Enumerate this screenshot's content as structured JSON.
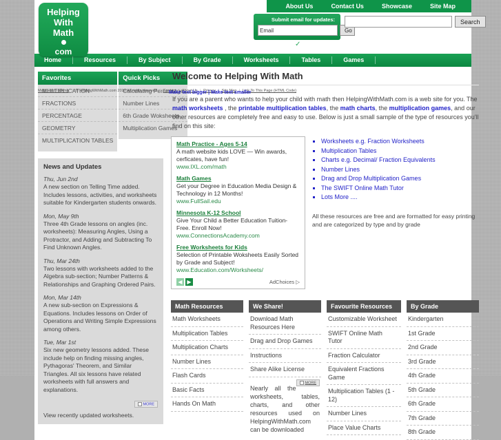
{
  "logo": {
    "line1": "Helping",
    "line2": "With",
    "line3": "Math",
    "line4": "com"
  },
  "topnav": {
    "items": [
      {
        "label": "About Us"
      },
      {
        "label": "Contact Us"
      },
      {
        "label": "Showcase"
      },
      {
        "label": "Site Map"
      }
    ]
  },
  "email_signup": {
    "label": "Submit email for updates:",
    "input_value": "Email",
    "placeholder": "Email",
    "button": "Go"
  },
  "search": {
    "value": "",
    "placeholder": "",
    "button": "Search"
  },
  "mainnav": {
    "items": [
      {
        "label": "Home"
      },
      {
        "label": "Resources"
      },
      {
        "label": "By Subject"
      },
      {
        "label": "By Grade"
      },
      {
        "label": "Worksheets"
      },
      {
        "label": "Tables"
      },
      {
        "label": "Games"
      }
    ]
  },
  "breadcrumb": {
    "home": "Math Help - Home",
    "copyright": "© HelpingWithMath.com 2010 All rights reserved",
    "contact": "Contact",
    "about": "About Us",
    "privacy": "Privacy",
    "sitemap": "Site Map",
    "linkto": "Link To This Page (HTML Code)",
    "resize": "Make text bigger | Make text smaller"
  },
  "favorites": {
    "title": "Favorites",
    "items": [
      "MULTIPLICATION",
      "FRACTIONS",
      "PERCENTAGE",
      "GEOMETRY",
      "MULTIPLICATION TABLES"
    ]
  },
  "quickpicks": {
    "title": "Quick Picks",
    "items": [
      "Calculating Percentage",
      "Number Lines",
      "6th Grade Woksheets",
      "Multiplication Games"
    ]
  },
  "news": {
    "title": "News and Updates",
    "entries": [
      {
        "date": "Thu, Jun 2nd",
        "text": "A new section on Telling Time added. Includes lessons, activities, and worksheets suitable for Kindergarten students onwards."
      },
      {
        "date": "Mon, May 9th",
        "text": "Three 4th Grade lessons on angles (inc. worksheets): Measuring Angles, Using a Protractor, and Adding and Subtracting To Find Unknown Angles."
      },
      {
        "date": "Thu, Mar 24th",
        "text": "Two lessons with worksheets added to the Algebra sub-section; Number Patterns & Relationships and Graphing Ordered Pairs."
      },
      {
        "date": "Mon, Mar 14th",
        "text": "A new sub-section on Expressions & Equations. Includes lessons on Order of Operations and Writing Simple Expressions among others."
      },
      {
        "date": "Tue, Mar 1st",
        "text": "Six new geometry lessons added. These include help on finding missing angles, Pythagoras' Theorem, and Similar Triangles. All six lessons have related worksheets with full answers and explanations."
      }
    ],
    "more_label": "MORE",
    "view_text": "View recently updated worksheets."
  },
  "welcome": {
    "heading": "Welcome to Helping With Math",
    "intro_1": "If you are a parent who wants to help your child with math then HelpingWithMath.com is a web site for you. The ",
    "link_worksheets": "math worksheets",
    "intro_2": " , the ",
    "link_tables": "printable multiplication tables",
    "intro_3": ", the ",
    "link_charts": "math charts",
    "intro_4": ", the ",
    "link_games": "multiplication games",
    "intro_5": ", and our other resources are completely free and easy to use. Below is just a small sample of the type of resources you'll find on this site:"
  },
  "ads": {
    "items": [
      {
        "title": "Math Practice - Ages 5-14",
        "desc": "A math website kids LOVE — Win awards, cerficates, have fun!",
        "url": "www.IXL.com/math"
      },
      {
        "title": "Math Games",
        "desc": "Get your Degree in Education Media Design & Technology in 12 Months!",
        "url": "www.FullSail.edu"
      },
      {
        "title": "Minnesota K-12 School",
        "desc": "Give Your Child a Better Education Tuition-Free. Enroll Now!",
        "url": "www.ConnectionsAcademy.com"
      },
      {
        "title": "Free Worksheets for Kids",
        "desc": "Selection of Printable Woksheets Easily Sorted by Grade and Subject!",
        "url": "www.Education.com/Worksheets/"
      }
    ],
    "prev": "◀",
    "next": "▶",
    "adchoices": "AdChoices"
  },
  "bullets": {
    "items": [
      "Worksheets e.g. Fraction Worksheets",
      "Multiplication Tables",
      "Charts e.g. Decimal/ Fraction Equivalents",
      "Number Lines",
      "Drag and Drop Multiplication Games",
      "The SWIFT Online Math Tutor",
      "Lots More ...."
    ],
    "note": "All these resources are free and are formatted for easy printing and are categorized by type and by grade"
  },
  "columns": [
    {
      "title": "Math Resources",
      "items": [
        "Math Worksheets",
        "Multiplication Tables",
        "Multiplication Charts",
        "Number Lines",
        "Flash Cards",
        "Basic Facts",
        "Hands On Math"
      ]
    },
    {
      "title": "We Share!",
      "items": [
        "Download Math Resources Here",
        "Drag and Drop Games",
        "Instructions",
        "Share Alike License"
      ],
      "more_label": "MORE",
      "note": "Nearly all the worksheets, tables, charts, and other resources used on HelpingWithMath.com can be downloaded"
    },
    {
      "title": "Favourite Resources",
      "items": [
        "Customizable Worksheet",
        "SWIFT Online Math Tutor",
        "Fraction Calculator",
        "Equivalent Fractions Game",
        "Multiplication Tables (1 - 12)",
        "Number Lines",
        "Place Value Charts"
      ]
    },
    {
      "title": "By Grade",
      "items": [
        "Kindergarten",
        "1st Grade",
        "2nd Grade",
        "3rd Grade",
        "4th Grade",
        "5th Grade",
        "6th Grade",
        "7th Grade",
        "8th Grade"
      ]
    }
  ],
  "colors": {
    "brand_green": "#0f9449",
    "link_blue": "#2323c8",
    "head_grey": "#555555"
  }
}
